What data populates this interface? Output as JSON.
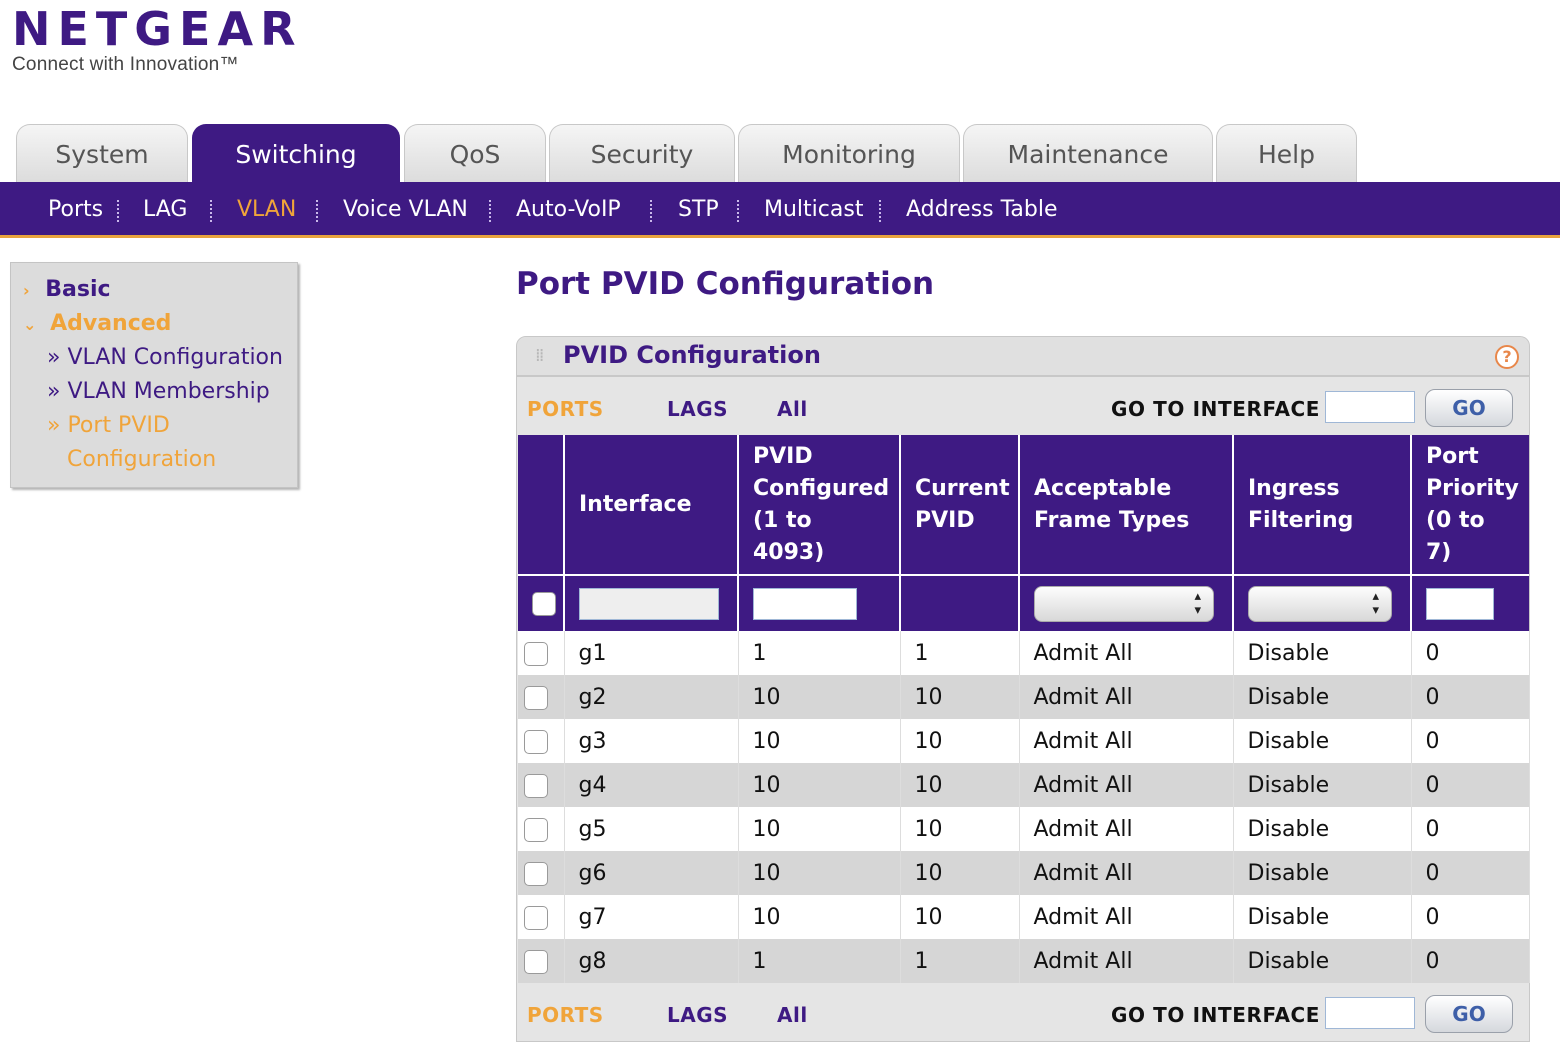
{
  "brand": {
    "name": "NETGEAR",
    "tagline": "Connect with Innovation™"
  },
  "tabs": [
    {
      "label": "System"
    },
    {
      "label": "Switching"
    },
    {
      "label": "QoS"
    },
    {
      "label": "Security"
    },
    {
      "label": "Monitoring"
    },
    {
      "label": "Maintenance"
    },
    {
      "label": "Help"
    }
  ],
  "active_tab": "Switching",
  "subnav": [
    {
      "label": "Ports"
    },
    {
      "label": "LAG"
    },
    {
      "label": "VLAN"
    },
    {
      "label": "Voice VLAN"
    },
    {
      "label": "Auto-VoIP"
    },
    {
      "label": "STP"
    },
    {
      "label": "Multicast"
    },
    {
      "label": "Address Table"
    }
  ],
  "active_subnav": "VLAN",
  "sidebar": {
    "basic": "Basic",
    "advanced": "Advanced",
    "links": [
      "» VLAN Configuration",
      "» VLAN Membership",
      "» Port PVID",
      "Configuration"
    ]
  },
  "page_title": "Port PVID Configuration",
  "panel": {
    "title": "PVID Configuration",
    "help": "?",
    "filters": [
      "PORTS",
      "LAGS",
      "All"
    ],
    "active_filter": "PORTS",
    "goto_label": "GO TO INTERFACE",
    "goto_value": "",
    "go_label": "GO"
  },
  "table": {
    "headers": [
      "",
      "Interface",
      "PVID Configured (1 to 4093)",
      "Current PVID",
      "Acceptable Frame Types",
      "Ingress Filtering",
      "Port Priority (0 to 7)"
    ],
    "rows": [
      {
        "interface": "g1",
        "pvid": "1",
        "current": "1",
        "frame": "Admit All",
        "ingress": "Disable",
        "priority": "0"
      },
      {
        "interface": "g2",
        "pvid": "10",
        "current": "10",
        "frame": "Admit All",
        "ingress": "Disable",
        "priority": "0"
      },
      {
        "interface": "g3",
        "pvid": "10",
        "current": "10",
        "frame": "Admit All",
        "ingress": "Disable",
        "priority": "0"
      },
      {
        "interface": "g4",
        "pvid": "10",
        "current": "10",
        "frame": "Admit All",
        "ingress": "Disable",
        "priority": "0"
      },
      {
        "interface": "g5",
        "pvid": "10",
        "current": "10",
        "frame": "Admit All",
        "ingress": "Disable",
        "priority": "0"
      },
      {
        "interface": "g6",
        "pvid": "10",
        "current": "10",
        "frame": "Admit All",
        "ingress": "Disable",
        "priority": "0"
      },
      {
        "interface": "g7",
        "pvid": "10",
        "current": "10",
        "frame": "Admit All",
        "ingress": "Disable",
        "priority": "0"
      },
      {
        "interface": "g8",
        "pvid": "1",
        "current": "1",
        "frame": "Admit All",
        "ingress": "Disable",
        "priority": "0"
      }
    ]
  },
  "colors": {
    "brand_purple": "#3e1a83",
    "accent_orange": "#f0a43a",
    "row_alt": "#d6d6d6"
  }
}
